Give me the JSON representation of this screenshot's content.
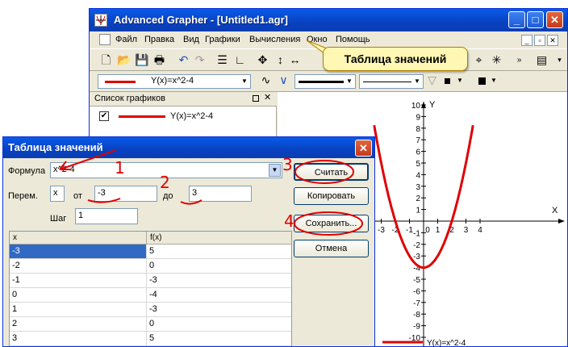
{
  "window": {
    "title": "Advanced Grapher - [Untitled1.agr]"
  },
  "menu": [
    "Файл",
    "Правка",
    "Вид",
    "Графики",
    "Вычисления",
    "Окно",
    "Помощь"
  ],
  "toolbar2": {
    "formula_combo": "Y(x)=x^2-4"
  },
  "callout": {
    "text": "Таблица значений"
  },
  "graph_list": {
    "title": "Список графиков",
    "entry_label": "Y(x)=x^2-4"
  },
  "plot": {
    "axis_x": "X",
    "axis_y": "Y",
    "y_ticks": [
      "10",
      "9",
      "8",
      "7",
      "6",
      "5",
      "4",
      "3",
      "2",
      "1",
      "-1",
      "-2",
      "-3",
      "-4",
      "-5",
      "-6",
      "-7",
      "-8",
      "-9",
      "-10"
    ],
    "x_ticks": [
      "-3",
      "-2",
      "-1",
      "0",
      "1",
      "2",
      "3",
      "4"
    ],
    "legend": "Y(x)=x^2-4",
    "curve_color": "#e00000"
  },
  "dialog": {
    "title": "Таблица значений",
    "formula_label": "Формула",
    "formula_value": "x^2-4",
    "var_label": "Перем.",
    "var_value": "x",
    "from_label": "от",
    "from_value": "-3",
    "to_label": "до",
    "to_value": "3",
    "step_label": "Шаг",
    "step_value": "1",
    "buttons": {
      "calc": "Считать",
      "copy": "Копировать",
      "save": "Сохранить...",
      "cancel": "Отмена"
    },
    "table": {
      "headers": [
        "x",
        "f(x)"
      ],
      "rows": [
        [
          "-3",
          "5"
        ],
        [
          "-2",
          "0"
        ],
        [
          "-1",
          "-3"
        ],
        [
          "0",
          "-4"
        ],
        [
          "1",
          "-3"
        ],
        [
          "2",
          "0"
        ],
        [
          "3",
          "5"
        ]
      ]
    },
    "annotations": [
      "1",
      "2",
      "3",
      "4"
    ]
  },
  "chart_data": {
    "type": "line",
    "series": [
      {
        "name": "Y(x)=x^2-4",
        "x": [
          -3.5,
          -3,
          -2,
          -1,
          0,
          1,
          2,
          3,
          3.5
        ],
        "values": [
          8.25,
          5,
          0,
          -3,
          -4,
          -3,
          0,
          5,
          8.25
        ]
      }
    ],
    "xlabel": "X",
    "ylabel": "Y",
    "ylim": [
      -10,
      10
    ]
  }
}
